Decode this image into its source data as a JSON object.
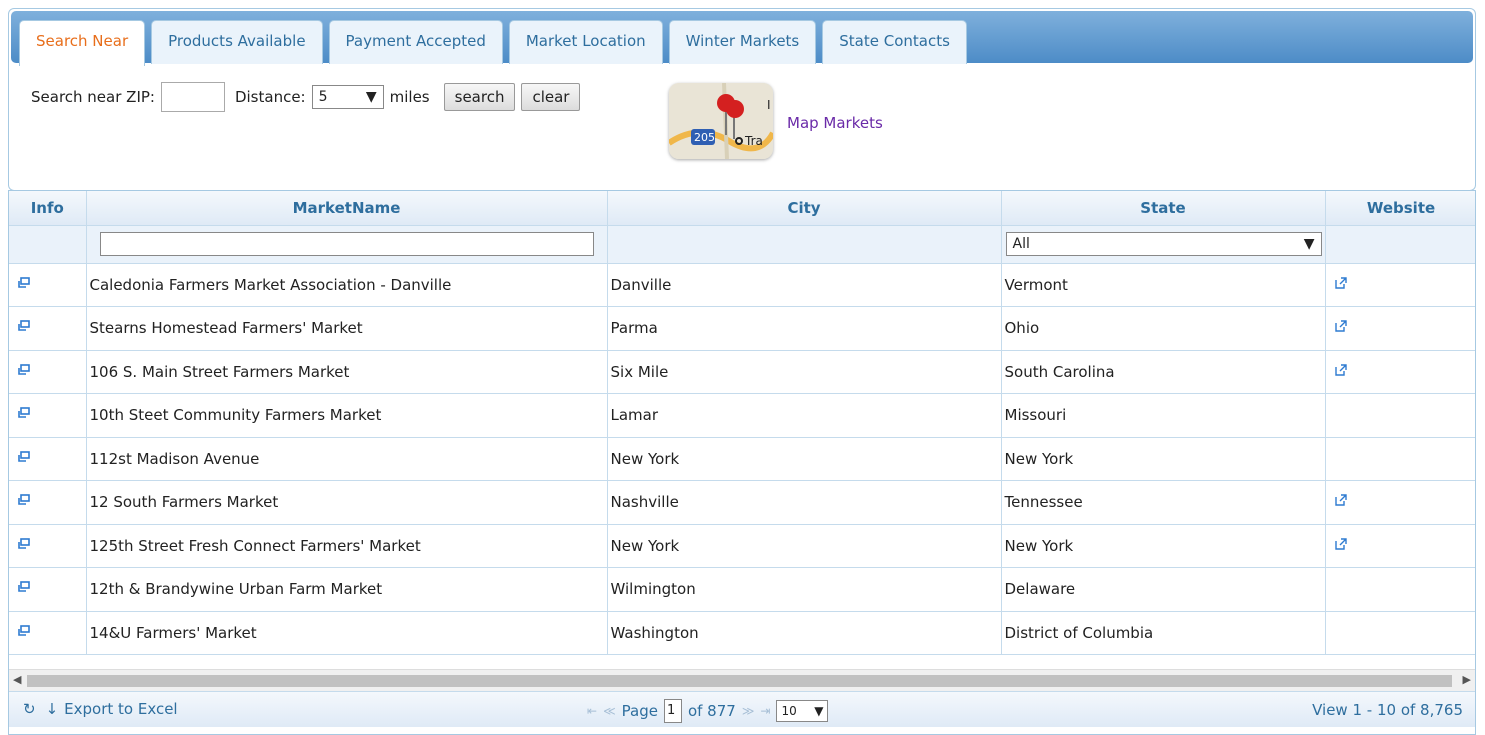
{
  "tabs": [
    {
      "label": "Search Near",
      "active": true
    },
    {
      "label": "Products Available"
    },
    {
      "label": "Payment Accepted"
    },
    {
      "label": "Market Location"
    },
    {
      "label": "Winter Markets"
    },
    {
      "label": "State Contacts"
    }
  ],
  "search": {
    "zip_label": "Search near ZIP:",
    "zip_value": "",
    "distance_label": "Distance:",
    "distance_value": "5",
    "miles_label": "miles",
    "search_button": "search",
    "clear_button": "clear",
    "map_link": "Map Markets"
  },
  "grid": {
    "columns": [
      "Info",
      "MarketName",
      "City",
      "State",
      "Website"
    ],
    "filter": {
      "market_name": "",
      "state": "All"
    },
    "rows": [
      {
        "name": "Caledonia Farmers Market Association - Danville",
        "city": "Danville",
        "state": "Vermont",
        "website": true
      },
      {
        "name": "Stearns Homestead Farmers' Market",
        "city": "Parma",
        "state": "Ohio",
        "website": true
      },
      {
        "name": "106 S. Main Street Farmers Market",
        "city": "Six Mile",
        "state": "South Carolina",
        "website": true
      },
      {
        "name": "10th Steet Community Farmers Market",
        "city": "Lamar",
        "state": "Missouri",
        "website": false
      },
      {
        "name": "112st Madison Avenue",
        "city": "New York",
        "state": "New York",
        "website": false
      },
      {
        "name": "12 South Farmers Market",
        "city": "Nashville",
        "state": "Tennessee",
        "website": true
      },
      {
        "name": "125th Street Fresh Connect Farmers' Market",
        "city": "New York",
        "state": "New York",
        "website": true
      },
      {
        "name": "12th & Brandywine Urban Farm Market",
        "city": "Wilmington",
        "state": "Delaware",
        "website": false
      },
      {
        "name": "14&U Farmers' Market",
        "city": "Washington",
        "state": "District of Columbia",
        "website": false
      }
    ]
  },
  "pager": {
    "export_label": "Export to Excel",
    "page_label": "Page",
    "page_value": "1",
    "of_label": "of 877",
    "rows_per_page": "10",
    "view_label": "View 1 - 10 of 8,765"
  },
  "colors": {
    "accent": "#2e6e9e",
    "active_tab": "#e86e1b",
    "link": "#6a2aa8"
  }
}
